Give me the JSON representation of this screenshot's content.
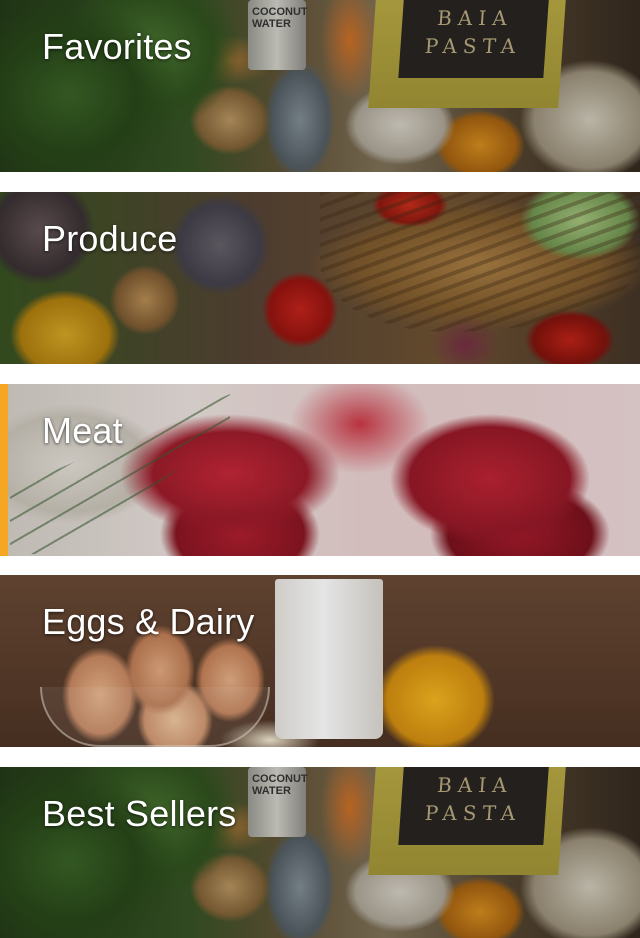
{
  "categories": [
    {
      "id": "favorites",
      "label": "Favorites",
      "selected": false
    },
    {
      "id": "produce",
      "label": "Produce",
      "selected": false
    },
    {
      "id": "meat",
      "label": "Meat",
      "selected": true
    },
    {
      "id": "eggs-dairy",
      "label": "Eggs & Dairy",
      "selected": false
    },
    {
      "id": "best-sellers",
      "label": "Best Sellers",
      "selected": false
    }
  ],
  "product_text": {
    "can_brand": "COCONUT\nWATER",
    "pasta_line1": "BAIA",
    "pasta_line2": "PASTA"
  },
  "colors": {
    "accent": "#f5a623",
    "label_text": "#ffffff",
    "divider": "#ffffff"
  }
}
